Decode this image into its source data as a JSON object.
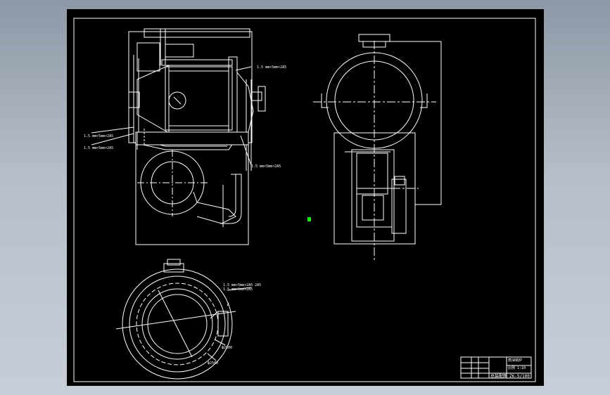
{
  "annotations": {
    "label_top_right": "1.5 mm×5mm×2A5",
    "label_left_1": "1.5 mm×5mm×2A5",
    "label_left_2": "1.5 mm×5mm×2A5",
    "label_mid_right": "1.5 mm×5mm×2A5",
    "label_circle_top": "1.5 mm×5mm×2A5 2A5",
    "label_circle_top2": "1.5 mm×5mm×2A5",
    "label_circle_right": "ф2500",
    "label_circle_bottom": "ф2500"
  },
  "title_block": {
    "code": "Z6-5/100",
    "title": "总装配图",
    "row1": "燃油锅炉",
    "row2": "比例 1:10"
  },
  "colors": {
    "background": "#000000",
    "line": "#ffffff",
    "cursor": "#00ff00",
    "app_bg": "#a9b2be"
  }
}
